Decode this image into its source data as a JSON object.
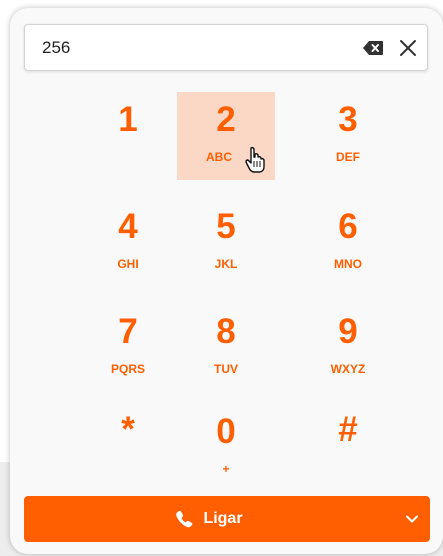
{
  "dialer": {
    "number_value": "256",
    "icons": {
      "backspace": "backspace-icon",
      "clear": "close-icon",
      "phone": "phone-icon",
      "chevron": "chevron-down-icon",
      "cursor": "hand-pointer-cursor-icon"
    },
    "keys": [
      {
        "digit": "1",
        "letters": ""
      },
      {
        "digit": "2",
        "letters": "ABC"
      },
      {
        "digit": "3",
        "letters": "DEF"
      },
      {
        "digit": "4",
        "letters": "GHI"
      },
      {
        "digit": "5",
        "letters": "JKL"
      },
      {
        "digit": "6",
        "letters": "MNO"
      },
      {
        "digit": "7",
        "letters": "PQRS"
      },
      {
        "digit": "8",
        "letters": "TUV"
      },
      {
        "digit": "9",
        "letters": "WXYZ"
      },
      {
        "digit": "*",
        "letters": ""
      },
      {
        "digit": "0",
        "letters": "+"
      },
      {
        "digit": "#",
        "letters": ""
      }
    ],
    "call_label": "Ligar",
    "colors": {
      "accent": "#ff5f00",
      "hover_key": "#fbd8c6",
      "panel": "#f9f9f9"
    }
  }
}
